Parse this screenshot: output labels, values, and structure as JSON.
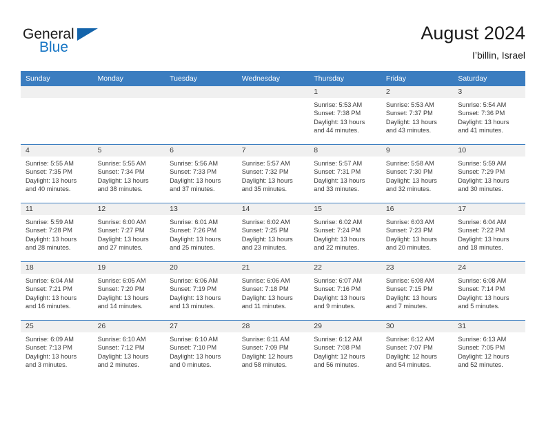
{
  "brand": {
    "name_part1": "General",
    "name_part2": "Blue",
    "triangle_color": "#1464ab",
    "blue_text_color": "#1675c4"
  },
  "header": {
    "title": "August 2024",
    "subtitle": "I’billin, Israel"
  },
  "calendar": {
    "header_bg": "#3b7dc0",
    "daynum_bg": "#f0f0f0",
    "weekday_headers": [
      "Sunday",
      "Monday",
      "Tuesday",
      "Wednesday",
      "Thursday",
      "Friday",
      "Saturday"
    ],
    "weeks": [
      [
        {
          "day": "",
          "lines": []
        },
        {
          "day": "",
          "lines": []
        },
        {
          "day": "",
          "lines": []
        },
        {
          "day": "",
          "lines": []
        },
        {
          "day": "1",
          "lines": [
            "Sunrise: 5:53 AM",
            "Sunset: 7:38 PM",
            "Daylight: 13 hours",
            "and 44 minutes."
          ]
        },
        {
          "day": "2",
          "lines": [
            "Sunrise: 5:53 AM",
            "Sunset: 7:37 PM",
            "Daylight: 13 hours",
            "and 43 minutes."
          ]
        },
        {
          "day": "3",
          "lines": [
            "Sunrise: 5:54 AM",
            "Sunset: 7:36 PM",
            "Daylight: 13 hours",
            "and 41 minutes."
          ]
        }
      ],
      [
        {
          "day": "4",
          "lines": [
            "Sunrise: 5:55 AM",
            "Sunset: 7:35 PM",
            "Daylight: 13 hours",
            "and 40 minutes."
          ]
        },
        {
          "day": "5",
          "lines": [
            "Sunrise: 5:55 AM",
            "Sunset: 7:34 PM",
            "Daylight: 13 hours",
            "and 38 minutes."
          ]
        },
        {
          "day": "6",
          "lines": [
            "Sunrise: 5:56 AM",
            "Sunset: 7:33 PM",
            "Daylight: 13 hours",
            "and 37 minutes."
          ]
        },
        {
          "day": "7",
          "lines": [
            "Sunrise: 5:57 AM",
            "Sunset: 7:32 PM",
            "Daylight: 13 hours",
            "and 35 minutes."
          ]
        },
        {
          "day": "8",
          "lines": [
            "Sunrise: 5:57 AM",
            "Sunset: 7:31 PM",
            "Daylight: 13 hours",
            "and 33 minutes."
          ]
        },
        {
          "day": "9",
          "lines": [
            "Sunrise: 5:58 AM",
            "Sunset: 7:30 PM",
            "Daylight: 13 hours",
            "and 32 minutes."
          ]
        },
        {
          "day": "10",
          "lines": [
            "Sunrise: 5:59 AM",
            "Sunset: 7:29 PM",
            "Daylight: 13 hours",
            "and 30 minutes."
          ]
        }
      ],
      [
        {
          "day": "11",
          "lines": [
            "Sunrise: 5:59 AM",
            "Sunset: 7:28 PM",
            "Daylight: 13 hours",
            "and 28 minutes."
          ]
        },
        {
          "day": "12",
          "lines": [
            "Sunrise: 6:00 AM",
            "Sunset: 7:27 PM",
            "Daylight: 13 hours",
            "and 27 minutes."
          ]
        },
        {
          "day": "13",
          "lines": [
            "Sunrise: 6:01 AM",
            "Sunset: 7:26 PM",
            "Daylight: 13 hours",
            "and 25 minutes."
          ]
        },
        {
          "day": "14",
          "lines": [
            "Sunrise: 6:02 AM",
            "Sunset: 7:25 PM",
            "Daylight: 13 hours",
            "and 23 minutes."
          ]
        },
        {
          "day": "15",
          "lines": [
            "Sunrise: 6:02 AM",
            "Sunset: 7:24 PM",
            "Daylight: 13 hours",
            "and 22 minutes."
          ]
        },
        {
          "day": "16",
          "lines": [
            "Sunrise: 6:03 AM",
            "Sunset: 7:23 PM",
            "Daylight: 13 hours",
            "and 20 minutes."
          ]
        },
        {
          "day": "17",
          "lines": [
            "Sunrise: 6:04 AM",
            "Sunset: 7:22 PM",
            "Daylight: 13 hours",
            "and 18 minutes."
          ]
        }
      ],
      [
        {
          "day": "18",
          "lines": [
            "Sunrise: 6:04 AM",
            "Sunset: 7:21 PM",
            "Daylight: 13 hours",
            "and 16 minutes."
          ]
        },
        {
          "day": "19",
          "lines": [
            "Sunrise: 6:05 AM",
            "Sunset: 7:20 PM",
            "Daylight: 13 hours",
            "and 14 minutes."
          ]
        },
        {
          "day": "20",
          "lines": [
            "Sunrise: 6:06 AM",
            "Sunset: 7:19 PM",
            "Daylight: 13 hours",
            "and 13 minutes."
          ]
        },
        {
          "day": "21",
          "lines": [
            "Sunrise: 6:06 AM",
            "Sunset: 7:18 PM",
            "Daylight: 13 hours",
            "and 11 minutes."
          ]
        },
        {
          "day": "22",
          "lines": [
            "Sunrise: 6:07 AM",
            "Sunset: 7:16 PM",
            "Daylight: 13 hours",
            "and 9 minutes."
          ]
        },
        {
          "day": "23",
          "lines": [
            "Sunrise: 6:08 AM",
            "Sunset: 7:15 PM",
            "Daylight: 13 hours",
            "and 7 minutes."
          ]
        },
        {
          "day": "24",
          "lines": [
            "Sunrise: 6:08 AM",
            "Sunset: 7:14 PM",
            "Daylight: 13 hours",
            "and 5 minutes."
          ]
        }
      ],
      [
        {
          "day": "25",
          "lines": [
            "Sunrise: 6:09 AM",
            "Sunset: 7:13 PM",
            "Daylight: 13 hours",
            "and 3 minutes."
          ]
        },
        {
          "day": "26",
          "lines": [
            "Sunrise: 6:10 AM",
            "Sunset: 7:12 PM",
            "Daylight: 13 hours",
            "and 2 minutes."
          ]
        },
        {
          "day": "27",
          "lines": [
            "Sunrise: 6:10 AM",
            "Sunset: 7:10 PM",
            "Daylight: 13 hours",
            "and 0 minutes."
          ]
        },
        {
          "day": "28",
          "lines": [
            "Sunrise: 6:11 AM",
            "Sunset: 7:09 PM",
            "Daylight: 12 hours",
            "and 58 minutes."
          ]
        },
        {
          "day": "29",
          "lines": [
            "Sunrise: 6:12 AM",
            "Sunset: 7:08 PM",
            "Daylight: 12 hours",
            "and 56 minutes."
          ]
        },
        {
          "day": "30",
          "lines": [
            "Sunrise: 6:12 AM",
            "Sunset: 7:07 PM",
            "Daylight: 12 hours",
            "and 54 minutes."
          ]
        },
        {
          "day": "31",
          "lines": [
            "Sunrise: 6:13 AM",
            "Sunset: 7:05 PM",
            "Daylight: 12 hours",
            "and 52 minutes."
          ]
        }
      ]
    ]
  }
}
